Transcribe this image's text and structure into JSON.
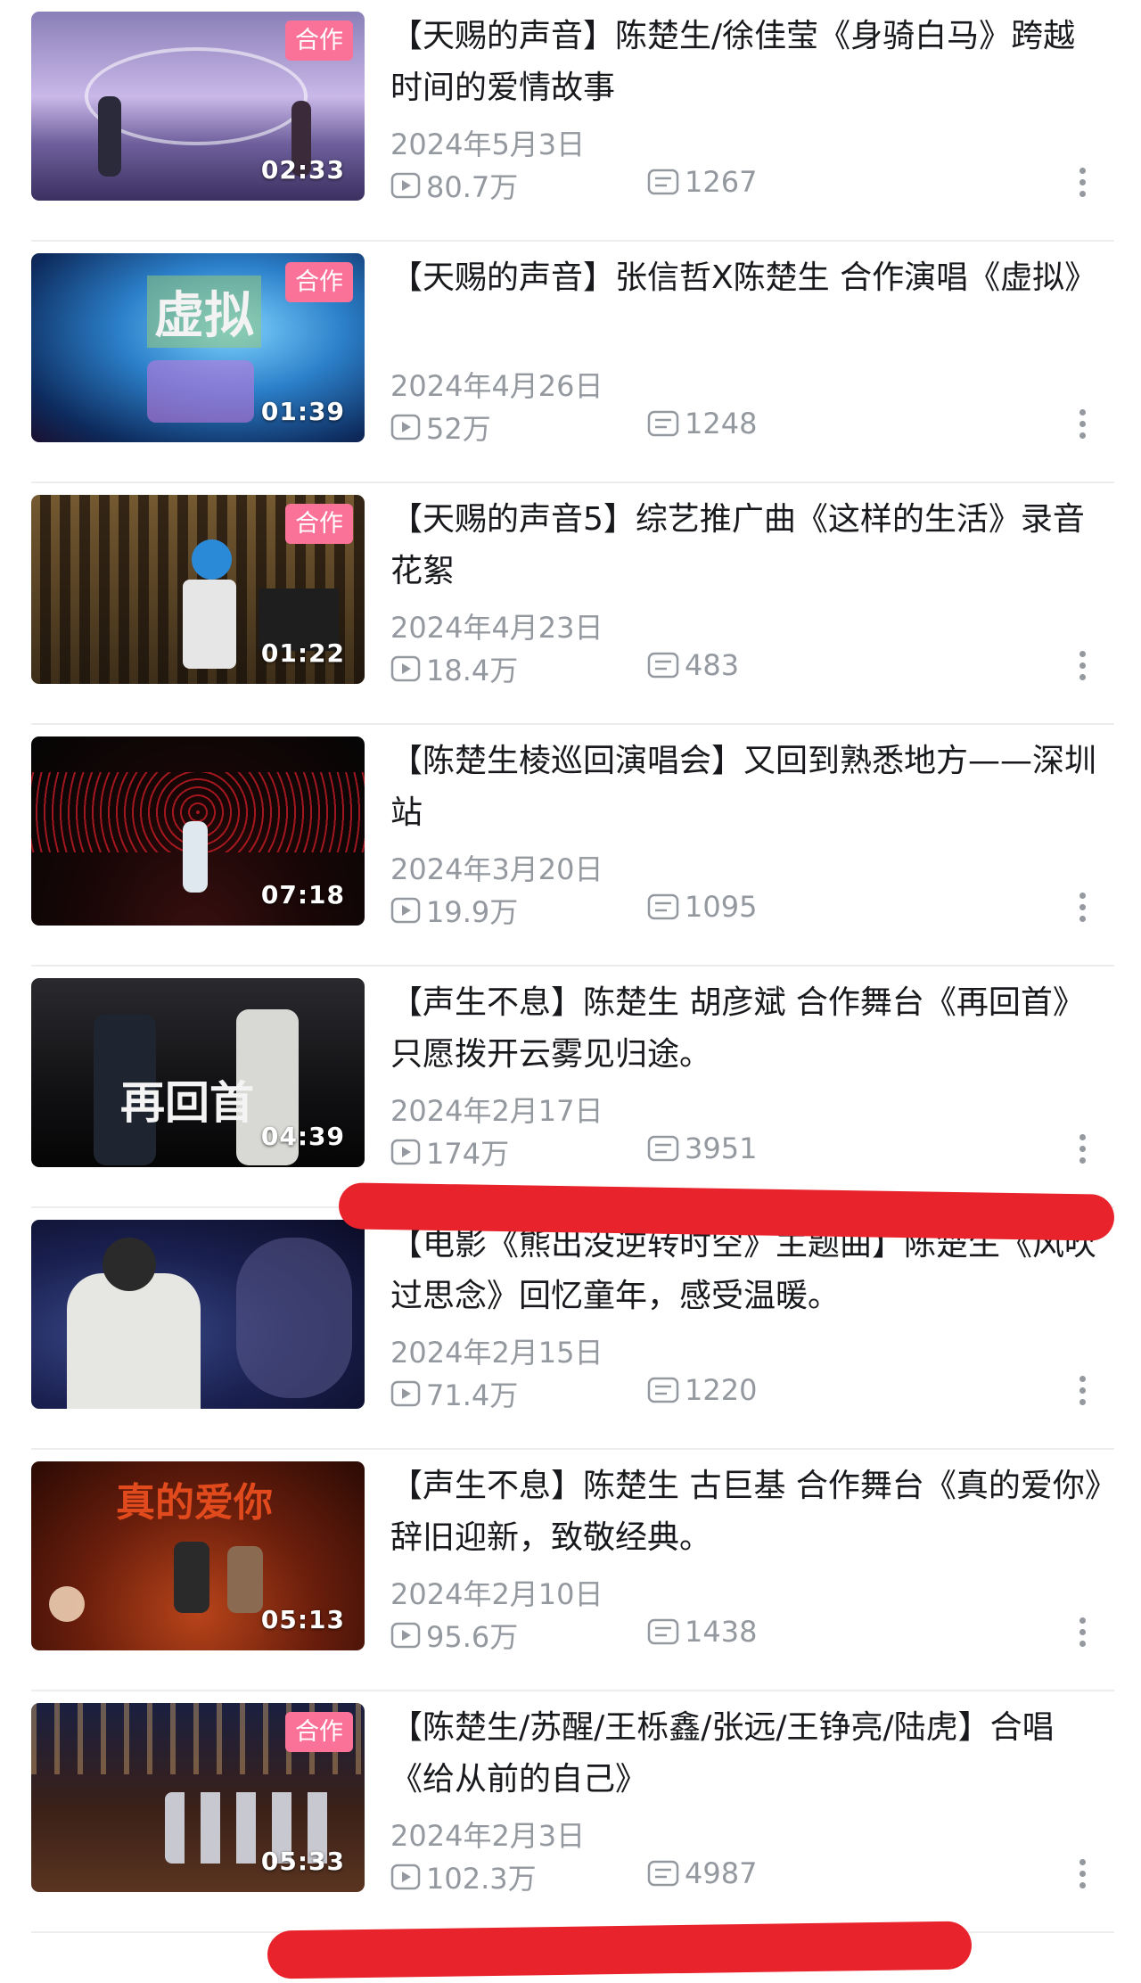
{
  "colors": {
    "badge": "#fb7299",
    "meta": "#9499a0",
    "highlight": "#e8232c"
  },
  "videos": [
    {
      "title": "【天赐的声音】陈楚生/徐佳莹《身骑白马》跨越时间的爱情故事",
      "badge": "合作",
      "duration": "02:33",
      "date": "2024年5月3日",
      "plays": "80.7万",
      "comments": "1267"
    },
    {
      "title": "【天赐的声音】张信哲X陈楚生 合作演唱《虚拟》",
      "badge": "合作",
      "duration": "01:39",
      "date": "2024年4月26日",
      "plays": "52万",
      "comments": "1248",
      "thumb_text": "虚拟"
    },
    {
      "title": "【天赐的声音5】综艺推广曲《这样的生活》录音花絮",
      "badge": "合作",
      "duration": "01:22",
      "date": "2024年4月23日",
      "plays": "18.4万",
      "comments": "483"
    },
    {
      "title": "【陈楚生棱巡回演唱会】又回到熟悉地方——深圳站",
      "duration": "07:18",
      "date": "2024年3月20日",
      "plays": "19.9万",
      "comments": "1095"
    },
    {
      "title": "【声生不息】陈楚生 胡彦斌 合作舞台《再回首》只愿拨开云雾见归途。",
      "duration": "04:39",
      "date": "2024年2月17日",
      "plays": "174万",
      "comments": "3951",
      "thumb_text": "再回首"
    },
    {
      "title": "【电影《熊出没逆转时空》主题曲】陈楚生《风吹过思念》回忆童年，感受温暖。",
      "duration": "",
      "date": "2024年2月15日",
      "plays": "71.4万",
      "comments": "1220"
    },
    {
      "title": "【声生不息】陈楚生 古巨基 合作舞台《真的爱你》辞旧迎新，致敬经典。",
      "duration": "05:13",
      "date": "2024年2月10日",
      "plays": "95.6万",
      "comments": "1438",
      "thumb_text": "真的爱你"
    },
    {
      "title": "【陈楚生/苏醒/王栎鑫/张远/王铮亮/陆虎】合唱《给从前的自己》",
      "badge": "合作",
      "duration": "05:33",
      "date": "2024年2月3日",
      "plays": "102.3万",
      "comments": "4987"
    }
  ]
}
